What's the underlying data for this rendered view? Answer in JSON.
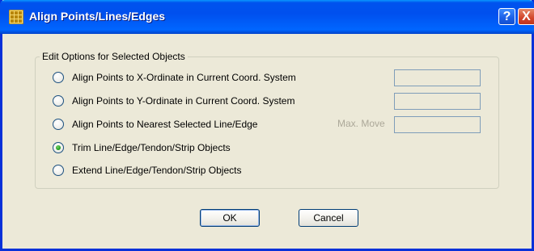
{
  "window": {
    "title": "Align Points/Lines/Edges",
    "help_glyph": "?",
    "close_glyph": "X"
  },
  "group": {
    "legend": "Edit Options for Selected Objects",
    "options": [
      {
        "label": "Align Points to X-Ordinate in Current Coord. System",
        "checked": false
      },
      {
        "label": "Align Points to Y-Ordinate in Current Coord. System",
        "checked": false
      },
      {
        "label": "Align Points to Nearest Selected Line/Edge",
        "checked": false
      },
      {
        "label": "Trim Line/Edge/Tendon/Strip Objects",
        "checked": true
      },
      {
        "label": "Extend Line/Edge/Tendon/Strip Objects",
        "checked": false
      }
    ],
    "x_value": "",
    "y_value": "",
    "max_move_label": "Max. Move",
    "max_move_value": ""
  },
  "buttons": {
    "ok": "OK",
    "cancel": "Cancel"
  },
  "colors": {
    "title_bar": "#0054e3",
    "dialog_bg": "#ece9d8",
    "radio_dot": "#21a121"
  }
}
